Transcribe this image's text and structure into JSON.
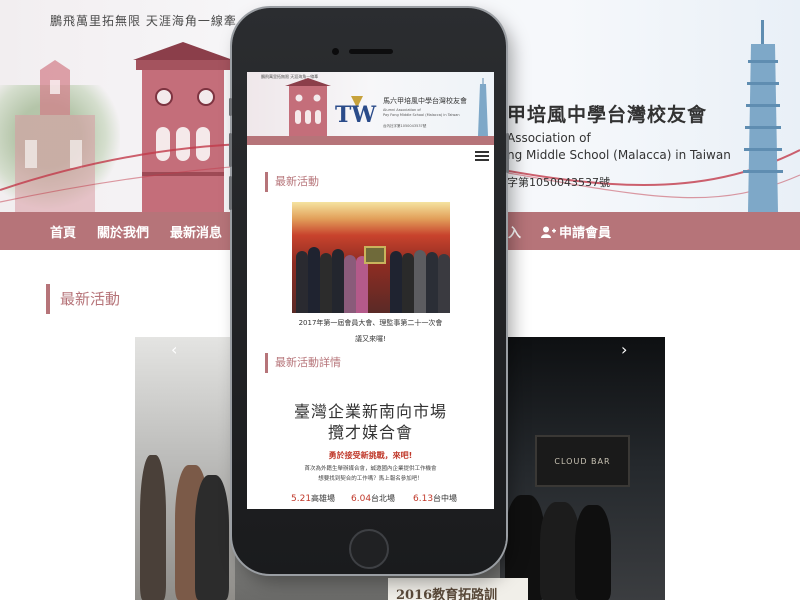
{
  "background_site": {
    "tagline": "鵬飛萬里拓無限 天涯海角一線牽",
    "association": {
      "zh_title": "甲培風中學台灣校友會",
      "en_line1": "Association of",
      "en_line2": "ng Middle School (Malacca) in Taiwan",
      "registration": "字第1050043537號"
    },
    "nav": {
      "items": [
        "首頁",
        "關於我們",
        "最新消息",
        "入"
      ],
      "apply_label": "申請會員"
    },
    "section_title": "最新活動",
    "photo": {
      "banner_text": "2016教育拓路訓",
      "storefront_text": "CLOUD BAR",
      "prev_arrow": "‹",
      "next_arrow": "›"
    }
  },
  "phone_screen": {
    "header": {
      "tagline": "鵬飛萬里拓無限 天涯海角一線牽",
      "logo_text": "TW",
      "zh_title": "馬六甲培風中學台灣校友會",
      "en_title_line1": "Alumni Association of",
      "en_title_line2": "Pay Fong Middle School (Malacca) in Taiwan",
      "registration": "台內社字第1050043537號"
    },
    "section1_title": "最新活動",
    "photo_caption_line1": "2017年第一屆會員大會、理監事第二十一次會",
    "photo_caption_line2": "議又來囉!",
    "section2_title": "最新活動詳情",
    "event_title_line1": "臺灣企業新南向市場",
    "event_title_line2": "攬才媒合會",
    "event_subtitle": "勇於接受新挑戰，來吧!",
    "event_desc_line1": "首次為外籍生舉辦媒合會，誠邀國內企業提供工作機會",
    "event_desc_line2": "想要找到契合的工作嗎？馬上報名參加吧！",
    "cities": [
      {
        "date": "5.21",
        "place": "高雄場"
      },
      {
        "date": "6.04",
        "place": "台北場"
      },
      {
        "date": "6.13",
        "place": "台中場"
      }
    ]
  },
  "colors": {
    "accent": "#b67479",
    "highlight_red": "#c0392b",
    "phone_body": "#1f2022"
  }
}
